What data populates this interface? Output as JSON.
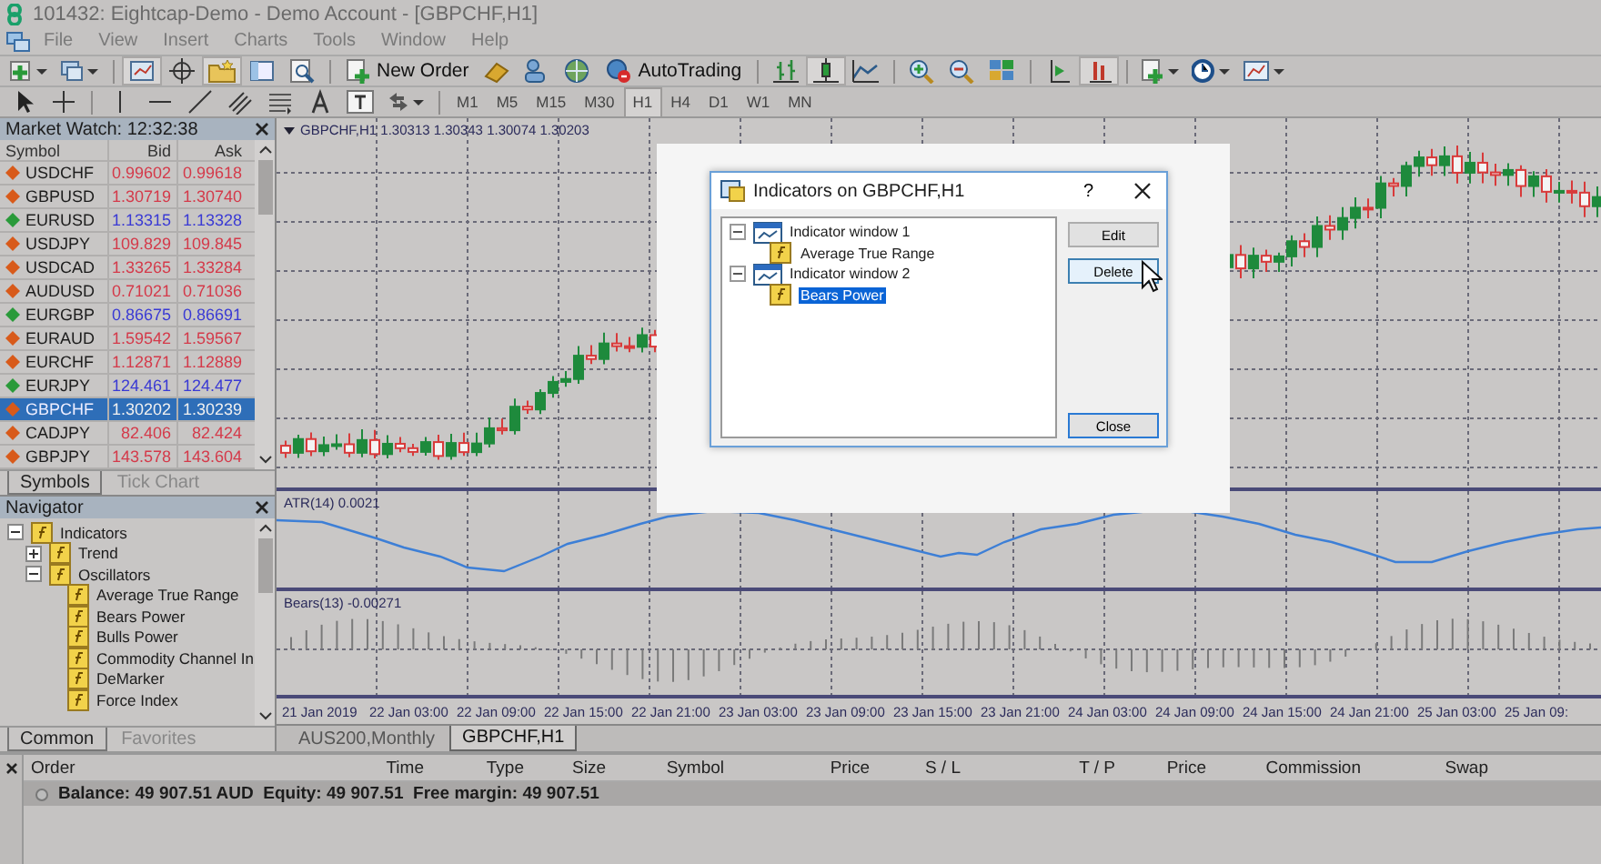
{
  "window": {
    "title": "101432: Eightcap-Demo - Demo Account - [GBPCHF,H1]"
  },
  "menu": [
    "File",
    "View",
    "Insert",
    "Charts",
    "Tools",
    "Window",
    "Help"
  ],
  "toolbar": {
    "new_order": "New Order",
    "auto_trading": "AutoTrading"
  },
  "timeframes": [
    {
      "label": "M1",
      "selected": false
    },
    {
      "label": "M5",
      "selected": false
    },
    {
      "label": "M15",
      "selected": false
    },
    {
      "label": "M30",
      "selected": false
    },
    {
      "label": "H1",
      "selected": true
    },
    {
      "label": "H4",
      "selected": false
    },
    {
      "label": "D1",
      "selected": false
    },
    {
      "label": "W1",
      "selected": false
    },
    {
      "label": "MN",
      "selected": false
    }
  ],
  "market_watch": {
    "title": "Market Watch: 12:32:38",
    "columns": [
      "Symbol",
      "Bid",
      "Ask"
    ],
    "rows": [
      {
        "symbol": "USDCHF",
        "bid": "0.99602",
        "ask": "0.99618",
        "rising": false,
        "selected": false
      },
      {
        "symbol": "GBPUSD",
        "bid": "1.30719",
        "ask": "1.30740",
        "rising": false,
        "selected": false
      },
      {
        "symbol": "EURUSD",
        "bid": "1.13315",
        "ask": "1.13328",
        "rising": true,
        "selected": false
      },
      {
        "symbol": "USDJPY",
        "bid": "109.829",
        "ask": "109.845",
        "rising": false,
        "selected": false
      },
      {
        "symbol": "USDCAD",
        "bid": "1.33265",
        "ask": "1.33284",
        "rising": false,
        "selected": false
      },
      {
        "symbol": "AUDUSD",
        "bid": "0.71021",
        "ask": "0.71036",
        "rising": false,
        "selected": false
      },
      {
        "symbol": "EURGBP",
        "bid": "0.86675",
        "ask": "0.86691",
        "rising": true,
        "selected": false
      },
      {
        "symbol": "EURAUD",
        "bid": "1.59542",
        "ask": "1.59567",
        "rising": false,
        "selected": false
      },
      {
        "symbol": "EURCHF",
        "bid": "1.12871",
        "ask": "1.12889",
        "rising": false,
        "selected": false
      },
      {
        "symbol": "EURJPY",
        "bid": "124.461",
        "ask": "124.477",
        "rising": true,
        "selected": false
      },
      {
        "symbol": "GBPCHF",
        "bid": "1.30202",
        "ask": "1.30239",
        "rising": false,
        "selected": true
      },
      {
        "symbol": "CADJPY",
        "bid": "82.406",
        "ask": "82.424",
        "rising": false,
        "selected": false
      },
      {
        "symbol": "GBPJPY",
        "bid": "143.578",
        "ask": "143.604",
        "rising": false,
        "selected": false
      }
    ],
    "tabs": [
      {
        "label": "Symbols",
        "selected": true
      },
      {
        "label": "Tick Chart",
        "selected": false
      }
    ]
  },
  "navigator": {
    "title": "Navigator",
    "tree": [
      {
        "label": "Indicators",
        "expanded": true,
        "children": [
          {
            "label": "Trend",
            "expanded": false
          },
          {
            "label": "Oscillators",
            "expanded": true,
            "children": [
              {
                "label": "Average True Range"
              },
              {
                "label": "Bears Power"
              },
              {
                "label": "Bulls Power"
              },
              {
                "label": "Commodity Channel In"
              },
              {
                "label": "DeMarker"
              },
              {
                "label": "Force Index"
              }
            ]
          }
        ]
      }
    ],
    "tabs": [
      {
        "label": "Common",
        "selected": true
      },
      {
        "label": "Favorites",
        "selected": false
      }
    ]
  },
  "chart": {
    "header": "GBPCHF,H1  1.30313 1.30343 1.30074 1.30203",
    "atr_label": "ATR(14) 0.0021",
    "bears_label": "Bears(13) -0.00271",
    "time_labels": [
      "21 Jan 2019",
      "22 Jan 03:00",
      "22 Jan 09:00",
      "22 Jan 15:00",
      "22 Jan 21:00",
      "23 Jan 03:00",
      "23 Jan 09:00",
      "23 Jan 15:00",
      "23 Jan 21:00",
      "24 Jan 03:00",
      "24 Jan 09:00",
      "24 Jan 15:00",
      "24 Jan 21:00",
      "25 Jan 03:00",
      "25 Jan 09:"
    ],
    "tabs": [
      {
        "label": "AUS200,Monthly",
        "selected": false
      },
      {
        "label": "GBPCHF,H1",
        "selected": true
      }
    ]
  },
  "dialog": {
    "title": "Indicators on GBPCHF,H1",
    "help": "?",
    "tree": [
      {
        "label": "Indicator window 1",
        "expanded": true,
        "children": [
          {
            "label": "Average True Range",
            "selected": false
          }
        ]
      },
      {
        "label": "Indicator window 2",
        "expanded": true,
        "children": [
          {
            "label": "Bears Power",
            "selected": true
          }
        ]
      }
    ],
    "buttons": [
      {
        "label": "Edit",
        "kind": "normal"
      },
      {
        "label": "Delete",
        "kind": "hover"
      }
    ],
    "close": "Close"
  },
  "terminal": {
    "columns": [
      "Order",
      "Time",
      "Type",
      "Size",
      "Symbol",
      "Price",
      "S / L",
      "T / P",
      "Price",
      "Commission",
      "Swap"
    ],
    "balance": "Balance: 49 907.51 AUD  Equity: 49 907.51  Free margin: 49 907.51"
  }
}
